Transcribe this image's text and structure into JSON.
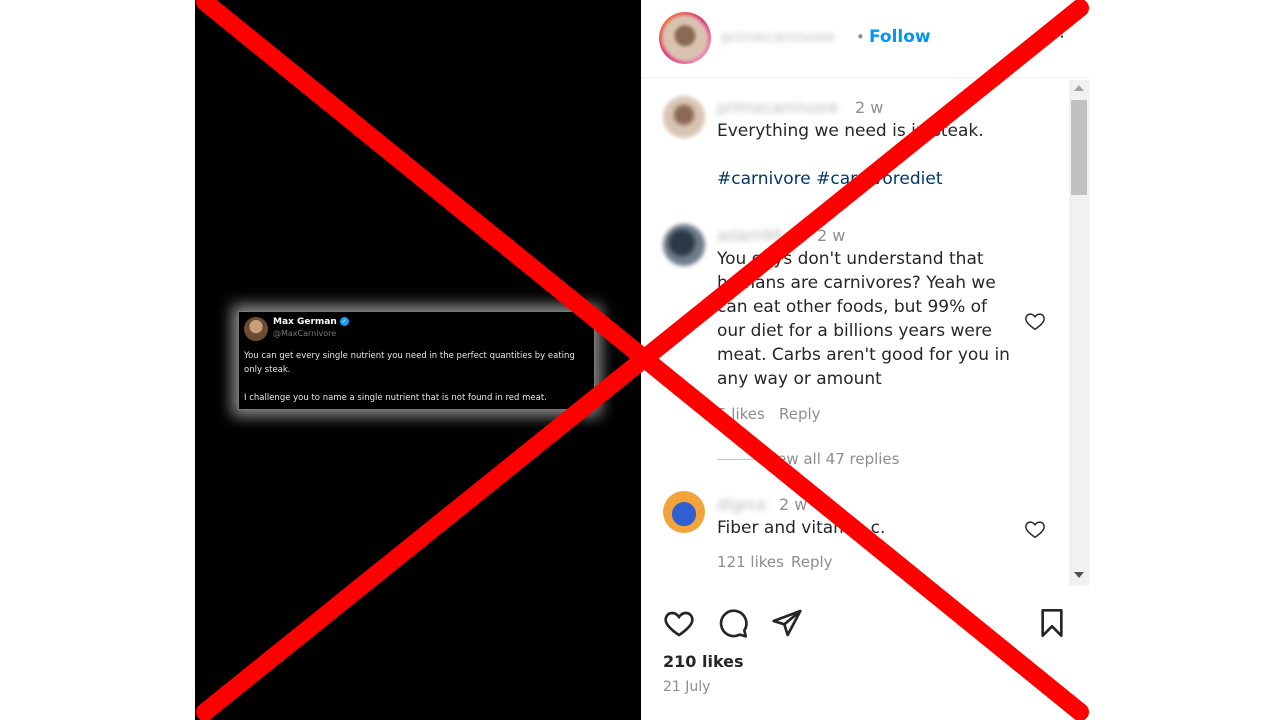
{
  "tweet": {
    "name": "Max German",
    "handle": "@MaxCarnivore",
    "verified_mark": "✓",
    "text_1": "You can get every single nutrient you need in the perfect quantities by eating only steak.",
    "text_2": "I challenge you to name a single nutrient that is not found in red meat."
  },
  "header": {
    "username": "primecarnivore",
    "separator": "•",
    "follow_label": "Follow",
    "more_label": "⋮"
  },
  "comments": [
    {
      "username": "primecarnivore",
      "time": "2 w",
      "text_line_1": "Everything we need is in steak.",
      "hashtags": "#carnivore #carnivorediet"
    },
    {
      "username": "adam99",
      "time": "2 w",
      "text": "You guys don't understand that humans are carnivores? Yeah we can eat other foods, but 99% of our diet for a billions years were meat. Carbs aren't good for you in any way or amount",
      "likes": "5 likes",
      "reply_label": "Reply",
      "view_replies": "View all 47 replies"
    },
    {
      "username": "dlgrce",
      "time": "2 w",
      "text": "Fiber and vitamin c.",
      "likes": "121 likes",
      "reply_label": "Reply"
    }
  ],
  "post": {
    "likes": "210 likes",
    "date": "21 July"
  },
  "colors": {
    "accent": "#0095f6",
    "overlay_x": "#ff0000",
    "hashtag": "#00376b"
  },
  "icons": [
    "heart-icon",
    "comment-icon",
    "share-icon",
    "bookmark-icon",
    "verified-icon",
    "more-icon"
  ]
}
